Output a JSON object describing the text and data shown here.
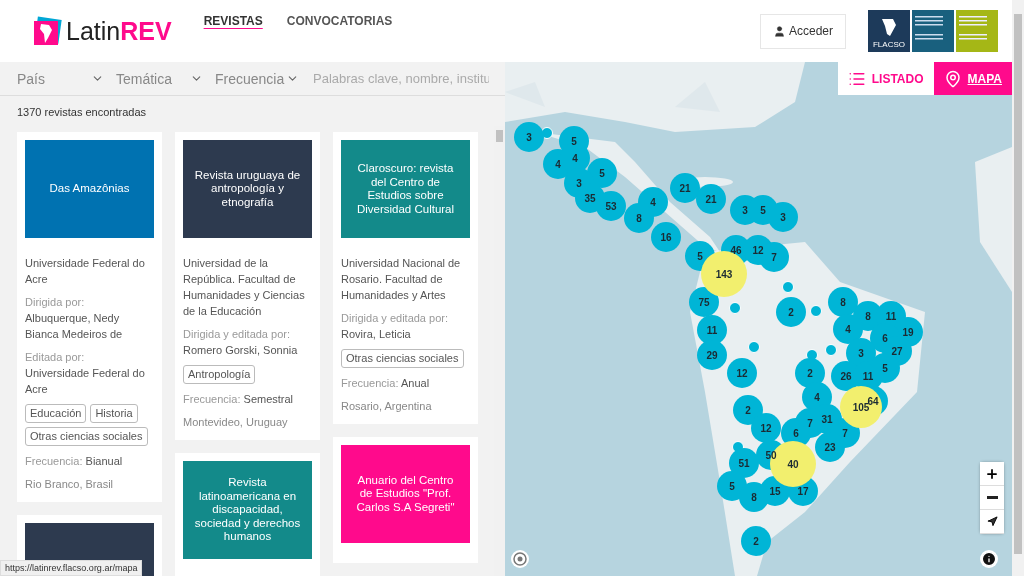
{
  "header": {
    "logo": {
      "text": "Latin",
      "accent": "REV"
    },
    "nav": [
      {
        "label": "REVISTAS",
        "selected": true
      },
      {
        "label": "CONVOCATORIAS",
        "selected": false
      }
    ],
    "login_button": "Acceder",
    "partner_logo": "FLACSO"
  },
  "filters": {
    "selects": [
      "País",
      "Temática",
      "Frecuencia"
    ],
    "search": {
      "placeholder": "Palabras clave, nombre, institu"
    }
  },
  "results_count": "1370 revistas encontradas",
  "columns": [
    [
      {
        "title": "Das Amazônias",
        "color": "#0072b1",
        "institution": "Universidade Federal do Acre",
        "credits": [
          {
            "label": "Dirigida por:",
            "names": "Albuquerque, Nedy Bianca Medeiros de"
          },
          {
            "label": "Editada por:",
            "names": "Universidade Federal do Acre"
          }
        ],
        "tags": [
          "Educación",
          "Historia",
          "Otras ciencias sociales"
        ],
        "frequency_label": "Frecuencia:",
        "frequency": "Bianual",
        "location": "Rio Branco, Brasil"
      },
      {
        "color": "#2d3a4f"
      }
    ],
    [
      {
        "title": "Revista uruguaya de antropología y etnografía",
        "color": "#2d3a4f",
        "institution": "Universidad de la República. Facultad de Humanidades y Ciencias de la Educación",
        "credits": [
          {
            "label": "Dirigida y editada por:",
            "names": "Romero Gorski, Sonnia"
          }
        ],
        "tags": [
          "Antropología"
        ],
        "frequency_label": "Frecuencia:",
        "frequency": "Semestral",
        "location": "Montevideo, Uruguay"
      },
      {
        "title": "Revista latinoamericana en discapacidad, sociedad y derechos humanos",
        "color": "#138a8a"
      }
    ],
    [
      {
        "title": "Claroscuro: revista del Centro de Estudios sobre Diversidad Cultural",
        "color": "#138a8a",
        "institution": "Universidad Nacional de Rosario. Facultad de Humanidades y Artes",
        "credits": [
          {
            "label": "Dirigida y editada por:",
            "names": "Rovira, Leticia"
          }
        ],
        "tags": [
          "Otras ciencias sociales"
        ],
        "frequency_label": "Frecuencia:",
        "frequency": "Anual",
        "location": "Rosario, Argentina"
      },
      {
        "title": "Anuario del Centro de Estudios \"Prof. Carlos S.A Segreti\"",
        "color": "#ff0a8c"
      }
    ]
  ],
  "view_toggle": [
    {
      "label": "LISTADO",
      "selected": false
    },
    {
      "label": "MAPA",
      "selected": true
    }
  ],
  "map": {
    "clusters": [
      {
        "count": "3",
        "color": "#00b5d6"
      },
      {
        "count": "5",
        "color": "#00b5d6"
      },
      {
        "count": "4",
        "color": "#00b5d6"
      },
      {
        "count": "4",
        "color": "#00b5d6"
      },
      {
        "count": "5",
        "color": "#00b5d6"
      },
      {
        "count": "3",
        "color": "#00b5d6"
      },
      {
        "count": "21",
        "color": "#00b5d6"
      },
      {
        "count": "35",
        "color": "#00b5d6"
      },
      {
        "count": "4",
        "color": "#00b5d6"
      },
      {
        "count": "21",
        "color": "#00b5d6"
      },
      {
        "count": "53",
        "color": "#00b5d6"
      },
      {
        "count": "3",
        "color": "#00b5d6"
      },
      {
        "count": "5",
        "color": "#00b5d6"
      },
      {
        "count": "8",
        "color": "#00b5d6"
      },
      {
        "count": "3",
        "color": "#00b5d6"
      },
      {
        "count": "16",
        "color": "#00b5d6"
      },
      {
        "count": "46",
        "color": "#00b5d6"
      },
      {
        "count": "12",
        "color": "#00b5d6"
      },
      {
        "count": "5",
        "color": "#00b5d6"
      },
      {
        "count": "7",
        "color": "#00b5d6"
      },
      {
        "count": "143",
        "color": "#f2ef6e"
      },
      {
        "count": "75",
        "color": "#00b5d6"
      },
      {
        "count": "8",
        "color": "#00b5d6"
      },
      {
        "count": "2",
        "color": "#00b5d6"
      },
      {
        "count": "8",
        "color": "#00b5d6"
      },
      {
        "count": "11",
        "color": "#00b5d6"
      },
      {
        "count": "11",
        "color": "#00b5d6"
      },
      {
        "count": "4",
        "color": "#00b5d6"
      },
      {
        "count": "19",
        "color": "#00b5d6"
      },
      {
        "count": "6",
        "color": "#00b5d6"
      },
      {
        "count": "29",
        "color": "#00b5d6"
      },
      {
        "count": "3",
        "color": "#00b5d6"
      },
      {
        "count": "27",
        "color": "#00b5d6"
      },
      {
        "count": "12",
        "color": "#00b5d6"
      },
      {
        "count": "2",
        "color": "#00b5d6"
      },
      {
        "count": "26",
        "color": "#00b5d6"
      },
      {
        "count": "11",
        "color": "#00b5d6"
      },
      {
        "count": "5",
        "color": "#00b5d6"
      },
      {
        "count": "4",
        "color": "#00b5d6"
      },
      {
        "count": "64",
        "color": "#00b5d6"
      },
      {
        "count": "2",
        "color": "#00b5d6"
      },
      {
        "count": "105",
        "color": "#f2ef6e"
      },
      {
        "count": "31",
        "color": "#00b5d6"
      },
      {
        "count": "7",
        "color": "#00b5d6"
      },
      {
        "count": "12",
        "color": "#00b5d6"
      },
      {
        "count": "6",
        "color": "#00b5d6"
      },
      {
        "count": "7",
        "color": "#00b5d6"
      },
      {
        "count": "23",
        "color": "#00b5d6"
      },
      {
        "count": "50",
        "color": "#00b5d6"
      },
      {
        "count": "51",
        "color": "#00b5d6"
      },
      {
        "count": "40",
        "color": "#f2ef6e"
      },
      {
        "count": "5",
        "color": "#00b5d6"
      },
      {
        "count": "15",
        "color": "#00b5d6"
      },
      {
        "count": "17",
        "color": "#00b5d6"
      },
      {
        "count": "8",
        "color": "#00b5d6"
      },
      {
        "count": "2",
        "color": "#00b5d6"
      }
    ]
  },
  "status_url": "https://latinrev.flacso.org.ar/mapa"
}
